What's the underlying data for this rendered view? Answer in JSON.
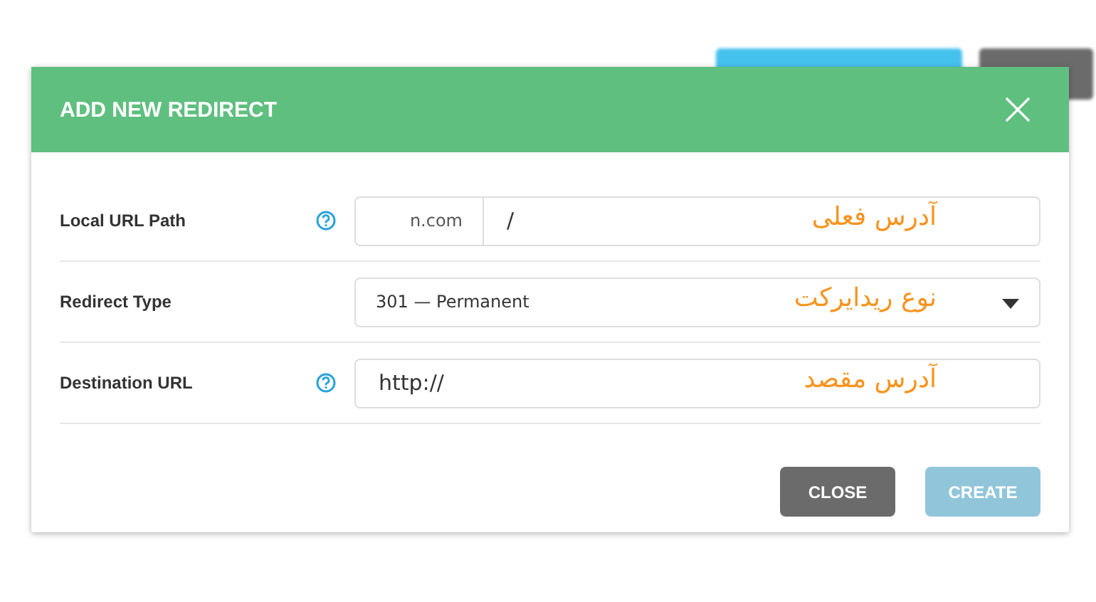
{
  "dialog": {
    "title": "ADD NEW REDIRECT",
    "rows": [
      {
        "kind": "path",
        "label": "Local URL Path",
        "help": true,
        "domain": "n.com",
        "value": "/",
        "annotation": "آدرس فعلی"
      },
      {
        "kind": "select",
        "label": "Redirect Type",
        "help": false,
        "value": "301 — Permanent",
        "annotation": "نوع ریدایرکت"
      },
      {
        "kind": "text",
        "label": "Destination URL",
        "help": true,
        "value": "http://",
        "annotation": "آدرس مقصد"
      }
    ],
    "buttons": [
      {
        "kind": "secondary",
        "label": "CLOSE",
        "disabled": false
      },
      {
        "kind": "primary",
        "label": "CREATE",
        "disabled": true
      }
    ]
  }
}
